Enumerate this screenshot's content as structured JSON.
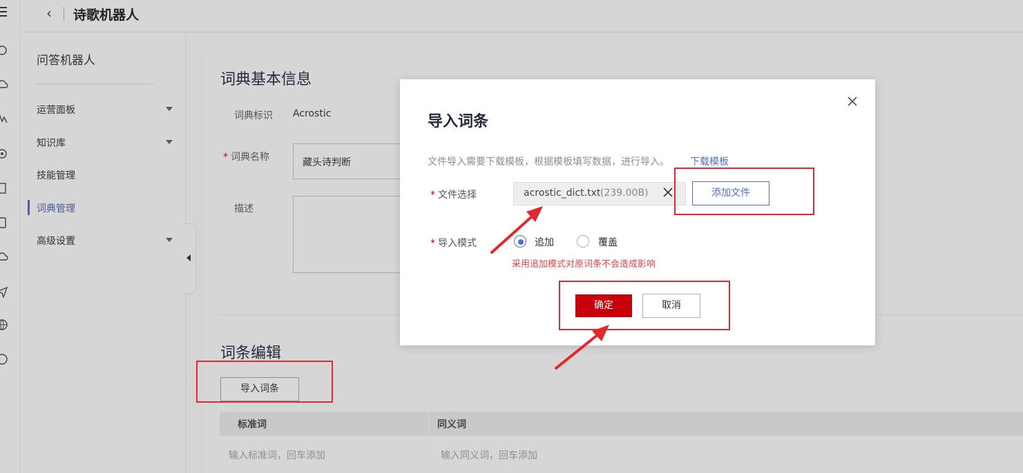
{
  "header": {
    "back_icon": "chevron-left-icon",
    "title": "诗歌机器人"
  },
  "sidebar": {
    "title": "问答机器人",
    "items": [
      {
        "label": "运营面板",
        "has_caret": true
      },
      {
        "label": "知识库",
        "has_caret": true
      },
      {
        "label": "技能管理",
        "has_caret": false
      },
      {
        "label": "词典管理",
        "has_caret": false,
        "active": true
      },
      {
        "label": "高级设置",
        "has_caret": true
      }
    ]
  },
  "dict_info": {
    "section_title": "词典基本信息",
    "id_label": "词典标识",
    "id_value": "Acrostic",
    "name_label": "词典名称",
    "name_value": "藏头诗判断",
    "desc_label": "描述"
  },
  "entries": {
    "section_title": "词条编辑",
    "import_button": "导入词条",
    "columns": [
      "标准词",
      "同义词"
    ],
    "placeholders": [
      "输入标准词，回车添加",
      "输入同义词，回车添加"
    ]
  },
  "modal": {
    "title": "导入词条",
    "hint": "文件导入需要下载模板，根据模板填写数据，进行导入。",
    "download_link": "下载模板",
    "file_label": "文件选择",
    "file_name": "acrostic_dict.txt",
    "file_size": "(239.00B)",
    "add_file_button": "添加文件",
    "mode_label": "导入模式",
    "mode_options": [
      "追加",
      "覆盖"
    ],
    "selected_mode": "追加",
    "mode_warning": "采用追加模式对原词条不会造成影响",
    "confirm_button": "确定",
    "cancel_button": "取消"
  },
  "colors": {
    "primary": "#526ecc",
    "danger": "#c7000b",
    "annotation": "#e0282e",
    "warning_text": "#e54545"
  }
}
